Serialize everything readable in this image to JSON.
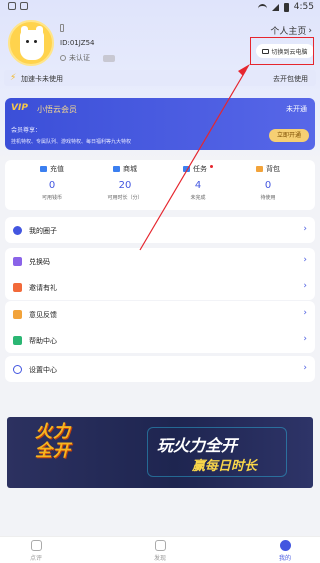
{
  "status_bar": {
    "time": "4:55"
  },
  "profile": {
    "user_id": "ID:01JZ54",
    "auth_status": "未认证",
    "homepage_link": "个人主页",
    "switch_pc_label": "切换到云电脑"
  },
  "accelerator": {
    "label": "加速卡未使用",
    "action": "去开包使用"
  },
  "vip": {
    "badge": "VIP",
    "title": "小悟云会员",
    "status": "未开通",
    "perks_title": "会员尊享：",
    "perks": "挂机特权、专属队列、游戏特权、每日福利等九大特权",
    "open_button": "立即开通"
  },
  "stats": [
    {
      "label": "充值",
      "value": "0",
      "sub": "可用钱币",
      "icon_color": "#3b7ff0"
    },
    {
      "label": "商城",
      "value": "20",
      "sub": "可用时长（分）",
      "icon_color": "#3b7ff0"
    },
    {
      "label": "任务",
      "value": "4",
      "sub": "未完成",
      "icon_color": "#3b7ff0"
    },
    {
      "label": "背包",
      "value": "0",
      "sub": "待使用",
      "icon_color": "#f2a33a"
    }
  ],
  "menu": {
    "circle": "我的圈子",
    "redeem": "兑换码",
    "invite": "邀请有礼",
    "feedback": "意见反馈",
    "help": "帮助中心",
    "settings": "设置中心"
  },
  "banner": {
    "left_text_1": "火力",
    "left_text_2": "全开",
    "main_text": "玩火力全开",
    "sub_text": "赢每日时长"
  },
  "tabs": [
    {
      "label": "点评"
    },
    {
      "label": "发现"
    },
    {
      "label": "我的"
    }
  ],
  "colors": {
    "accent": "#4356e0",
    "highlight_box": "#e6262e"
  }
}
